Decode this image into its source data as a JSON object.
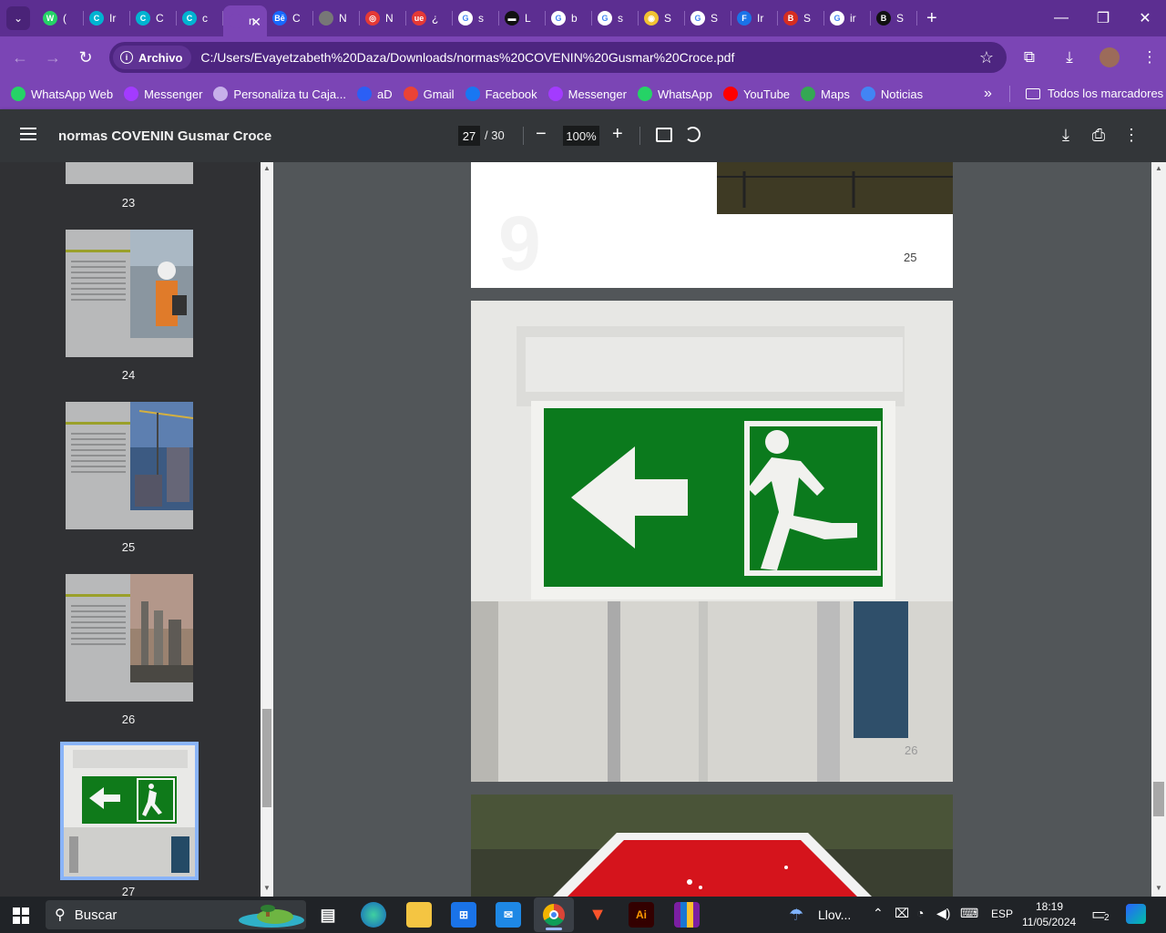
{
  "browser": {
    "tabs": [
      {
        "label": "(",
        "fav": "W",
        "color": "#25d366"
      },
      {
        "label": "Ir",
        "fav": "C",
        "color": "#00b3d1"
      },
      {
        "label": "C",
        "fav": "C",
        "color": "#00b3d1"
      },
      {
        "label": "c",
        "fav": "C",
        "color": "#00b3d1"
      },
      {
        "label": "n",
        "fav": "",
        "color": "#7b45b5",
        "active": true
      },
      {
        "label": "C",
        "fav": "Bē",
        "color": "#1769ff"
      },
      {
        "label": "N",
        "fav": "",
        "color": "#777"
      },
      {
        "label": "N",
        "fav": "◎",
        "color": "#e53935"
      },
      {
        "label": "¿",
        "fav": "ue",
        "color": "#e53935"
      },
      {
        "label": "s",
        "fav": "G",
        "color": "#ffffff"
      },
      {
        "label": "L",
        "fav": "▬",
        "color": "#111"
      },
      {
        "label": "b",
        "fav": "G",
        "color": "#ffffff"
      },
      {
        "label": "s",
        "fav": "G",
        "color": "#ffffff"
      },
      {
        "label": "S",
        "fav": "◉",
        "color": "#f1c232"
      },
      {
        "label": "S",
        "fav": "G",
        "color": "#ffffff"
      },
      {
        "label": "Ir",
        "fav": "F",
        "color": "#1a73e8"
      },
      {
        "label": "S",
        "fav": "B",
        "color": "#d62d20"
      },
      {
        "label": "ir",
        "fav": "G",
        "color": "#ffffff"
      },
      {
        "label": "S",
        "fav": "B",
        "color": "#111"
      }
    ],
    "chip_label": "Archivo",
    "url": "C:/Users/Evayetzabeth%20Daza/Downloads/normas%20COVENIN%20Gusmar%20Croce.pdf",
    "bookmarks": [
      {
        "label": "WhatsApp Web",
        "icon": "whatsapp-icon",
        "color": "#25d366"
      },
      {
        "label": "Messenger",
        "icon": "messenger-icon",
        "color": "#a33bff"
      },
      {
        "label": "Personaliza tu Caja...",
        "icon": "box-icon",
        "color": "#c7b0ea"
      },
      {
        "label": "aD",
        "icon": "ad-icon",
        "color": "#2b5ff5"
      },
      {
        "label": "Gmail",
        "icon": "gmail-icon",
        "color": "#ea4335"
      },
      {
        "label": "Facebook",
        "icon": "facebook-icon",
        "color": "#1877f2"
      },
      {
        "label": "Messenger",
        "icon": "messenger-icon",
        "color": "#a33bff"
      },
      {
        "label": "WhatsApp",
        "icon": "whatsapp-icon",
        "color": "#25d366"
      },
      {
        "label": "YouTube",
        "icon": "youtube-icon",
        "color": "#ff0000"
      },
      {
        "label": "Maps",
        "icon": "maps-icon",
        "color": "#34a853"
      },
      {
        "label": "Noticias",
        "icon": "news-icon",
        "color": "#4285f4"
      }
    ],
    "all_bookmarks": "Todos los marcadores"
  },
  "pdf": {
    "title": "normas COVENIN Gusmar Croce",
    "current_page": "27",
    "total_pages": "/ 30",
    "zoom": "100%",
    "thumbnails": [
      {
        "label": "23"
      },
      {
        "label": "24",
        "heading": "INDUSTRIA MANUFACTURERA"
      },
      {
        "label": "25",
        "heading": "CONSTRUCCIÓN"
      },
      {
        "label": "26",
        "heading": "SECTOR PETROLERO"
      },
      {
        "label": "27"
      }
    ],
    "page_numbers": {
      "p25": "25",
      "p26": "26"
    }
  },
  "taskbar": {
    "search_placeholder": "Buscar",
    "weather": "Llov...",
    "language": "ESP",
    "time": "18:19",
    "date": "11/05/2024",
    "notifications": "2"
  }
}
